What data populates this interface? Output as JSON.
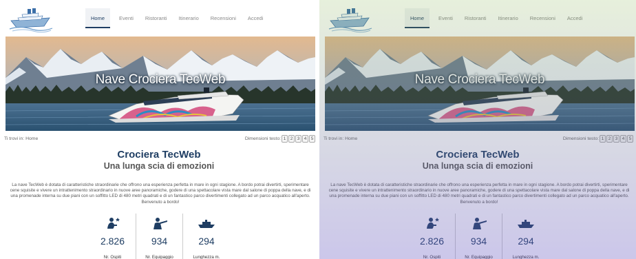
{
  "nav": [
    "Home",
    "Eventi",
    "Ristoranti",
    "Itinerario",
    "Recensioni",
    "Accedi"
  ],
  "hero": {
    "title": "Nave Crociera TecWeb"
  },
  "breadcrumb": "Ti trovi in: Home",
  "text_size": {
    "label": "Dimensioni testo:",
    "options": [
      "1",
      "2",
      "3",
      "4",
      "5"
    ]
  },
  "title": "Crociera TecWeb",
  "subtitle": "Una lunga scia di emozioni",
  "description": "La nave TecWeb è dotata di caratteristiche straordinarie che offrono una esperienza perfetta in mare in ogni stagione. A bordo potrai divertirti, sperimentare cene squisite e vivere un intrattenimento straordinario in nuove aree panoramiche, godere di una spettacolare vista mare dal salone di poppa della nave, e di una promenade interna su due piani con un soffitto LED di 480 metri quadrati e di un fantastico parco divertimenti collegato ad un parco acquatico all'aperto. Benvenuto a bordo!",
  "stats": [
    {
      "icon": "guests-icon",
      "value": "2.826",
      "label": "Nr. Ospiti"
    },
    {
      "icon": "crew-icon",
      "value": "934",
      "label": "Nr. Equipaggio"
    },
    {
      "icon": "ship-icon",
      "value": "294",
      "label": "Lunghezza m."
    }
  ],
  "colors": {
    "accent": "#1f3e63",
    "text": "#555555"
  }
}
